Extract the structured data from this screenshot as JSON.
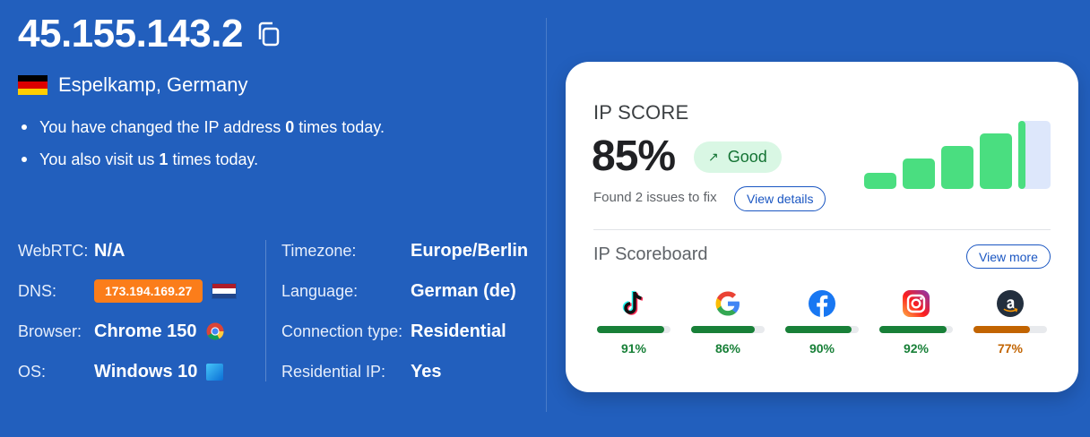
{
  "ip": "45.155.143.2",
  "location": "Espelkamp, Germany",
  "bullets": [
    {
      "pre": "You have changed the IP address",
      "num": "0",
      "post": "times today."
    },
    {
      "pre": "You also visit us",
      "num": "1",
      "post": "times today."
    }
  ],
  "info_left": {
    "webrtc_label": "WebRTC:",
    "webrtc_value": "N/A",
    "dns_label": "DNS:",
    "dns_value": "173.194.169.27",
    "browser_label": "Browser:",
    "browser_value": "Chrome 150",
    "os_label": "OS:",
    "os_value": "Windows 10"
  },
  "info_right": {
    "timezone_label": "Timezone:",
    "timezone_value": "Europe/Berlin",
    "language_label": "Language:",
    "language_value": "German (de)",
    "conn_label": "Connection type:",
    "conn_value": "Residential",
    "resip_label": "Residential IP:",
    "resip_value": "Yes"
  },
  "score": {
    "title": "IP SCORE",
    "value": "85%",
    "value_fraction": 0.85,
    "badge": "Good",
    "issues": "Found 2 issues to fix",
    "view_details": "View details"
  },
  "board": {
    "title": "IP Scoreboard",
    "view_more": "View more",
    "sites": [
      {
        "icon": "tiktok-icon",
        "pct": "91%",
        "value": 0.91,
        "color": "#188038"
      },
      {
        "icon": "google-icon",
        "pct": "86%",
        "value": 0.86,
        "color": "#188038"
      },
      {
        "icon": "facebook-icon",
        "pct": "90%",
        "value": 0.9,
        "color": "#188038"
      },
      {
        "icon": "instagram-icon",
        "pct": "92%",
        "value": 0.92,
        "color": "#188038"
      },
      {
        "icon": "amazon-icon",
        "pct": "77%",
        "value": 0.77,
        "color": "#c26401"
      }
    ]
  },
  "colors": {
    "background": "#225fbd",
    "dns_badge": "#fb7d1a",
    "good_green": "#4ade80",
    "accent_blue": "#1a56c2"
  }
}
